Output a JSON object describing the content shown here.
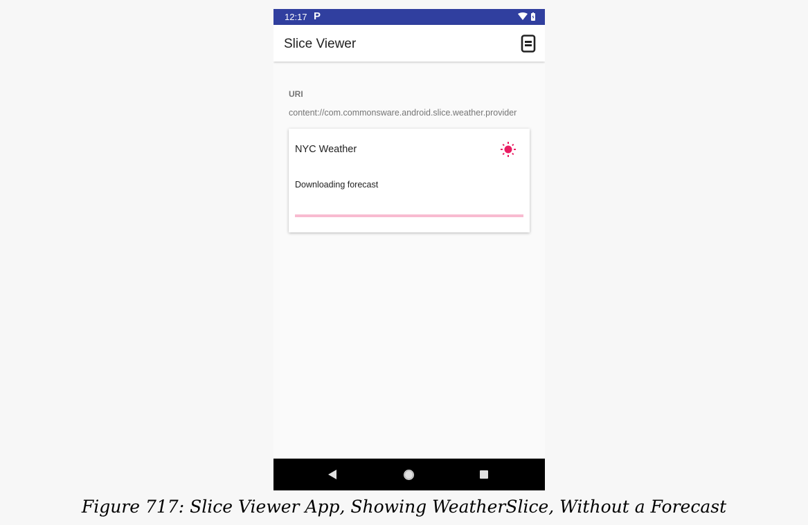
{
  "status_bar": {
    "time": "12:17",
    "notification": "P",
    "icons": [
      "wifi-icon",
      "battery-icon"
    ]
  },
  "app_bar": {
    "title": "Slice Viewer",
    "action_icon": "view-mode-icon"
  },
  "uri": {
    "label": "URI",
    "value": "content://com.commonsware.android.slice.weather.provider"
  },
  "slice": {
    "title": "NYC Weather",
    "icon": "sun-icon",
    "subtitle": "Downloading forecast",
    "progress": 0
  },
  "nav_bar": {
    "icons": [
      "back-icon",
      "home-icon",
      "recents-icon"
    ]
  },
  "caption": "Figure 717: Slice Viewer App, Showing WeatherSlice, Without a Forecast",
  "colors": {
    "status_bar": "#303f9f",
    "accent": "#e91e63",
    "progress_track": "#f8bbd0",
    "nav_bar": "#000000"
  }
}
